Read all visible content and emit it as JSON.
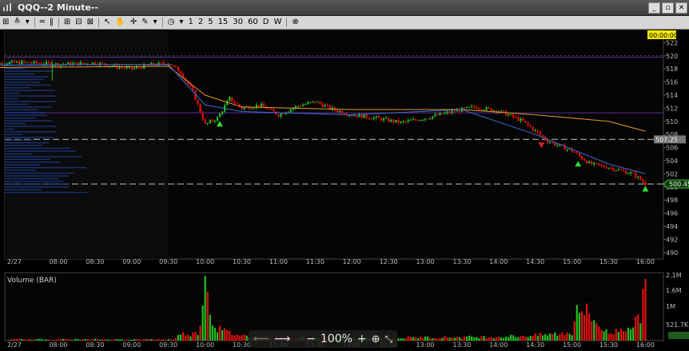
{
  "window": {
    "title": "QQQ--2 Minute--",
    "min_label": "_",
    "restore_label": "▫",
    "close_label": "✕"
  },
  "toolbar": {
    "timeframes": [
      "1",
      "2",
      "5",
      "15",
      "30",
      "60",
      "D",
      "W"
    ]
  },
  "price_label_top": "00:00:00",
  "price_markers": {
    "upper": "507.25",
    "last": "500.45"
  },
  "volume_title": "Volume (BAR)",
  "nav": {
    "zoom": "100%"
  },
  "colors": {
    "up": "#21c021",
    "down": "#e01010",
    "bg": "#000000",
    "ema_slow": "#e8962a",
    "ema_fast": "#3a6fd8"
  },
  "chart_data": {
    "type": "candlestick",
    "date_label": "2/27",
    "x_ticks": [
      "08:00",
      "08:30",
      "09:00",
      "09:30",
      "10:00",
      "10:30",
      "11:00",
      "11:30",
      "12:00",
      "12:30",
      "13:00",
      "13:30",
      "14:00",
      "14:30",
      "15:00",
      "15:30",
      "16:00"
    ],
    "y_ticks": [
      490,
      492,
      494,
      496,
      498,
      500,
      502,
      504,
      506,
      508,
      510,
      512,
      514,
      516,
      518,
      520,
      522
    ],
    "ylim": [
      489,
      524
    ],
    "volume_ticks": [
      "2.1M",
      "1.6M",
      "1M",
      "521.7K"
    ],
    "volume_max": 2100000,
    "close_path": [
      [
        "07:00",
        518.8
      ],
      [
        "07:30",
        519.0
      ],
      [
        "08:00",
        518.7
      ],
      [
        "08:30",
        518.9
      ],
      [
        "09:00",
        518.0
      ],
      [
        "09:15",
        518.6
      ],
      [
        "09:30",
        518.9
      ],
      [
        "09:40",
        517.5
      ],
      [
        "09:50",
        514.5
      ],
      [
        "10:00",
        509.5
      ],
      [
        "10:10",
        510.5
      ],
      [
        "10:20",
        513.5
      ],
      [
        "10:30",
        512.0
      ],
      [
        "10:45",
        512.5
      ],
      [
        "11:00",
        511.0
      ],
      [
        "11:15",
        512.3
      ],
      [
        "11:30",
        513.0
      ],
      [
        "11:45",
        511.8
      ],
      [
        "12:00",
        511.0
      ],
      [
        "12:20",
        510.5
      ],
      [
        "12:40",
        509.8
      ],
      [
        "13:00",
        510.5
      ],
      [
        "13:20",
        511.4
      ],
      [
        "13:40",
        512.2
      ],
      [
        "14:00",
        511.6
      ],
      [
        "14:20",
        510.0
      ],
      [
        "14:40",
        507.0
      ],
      [
        "15:00",
        505.5
      ],
      [
        "15:15",
        503.5
      ],
      [
        "15:30",
        503.0
      ],
      [
        "15:50",
        502.0
      ],
      [
        "16:00",
        500.5
      ]
    ],
    "ema_slow": [
      [
        "07:00",
        518.2
      ],
      [
        "09:30",
        518.4
      ],
      [
        "10:00",
        514.0
      ],
      [
        "10:30",
        512.2
      ],
      [
        "12:00",
        511.8
      ],
      [
        "13:30",
        511.8
      ],
      [
        "14:30",
        511.0
      ],
      [
        "15:30",
        510.0
      ],
      [
        "16:00",
        508.5
      ]
    ],
    "ema_fast": [
      [
        "07:00",
        518.6
      ],
      [
        "09:30",
        518.7
      ],
      [
        "10:00",
        512.5
      ],
      [
        "10:30",
        511.5
      ],
      [
        "12:00",
        511.0
      ],
      [
        "13:30",
        511.8
      ],
      [
        "14:30",
        508.0
      ],
      [
        "15:30",
        503.5
      ],
      [
        "16:00",
        502.0
      ]
    ],
    "hlines": [
      520.0,
      507.25,
      500.45
    ],
    "purple_lines": [
      519.8,
      511.3
    ],
    "up_arrows": [
      [
        "10:12",
        509.7
      ],
      [
        "15:05",
        503.6
      ],
      [
        "16:00",
        499.8
      ]
    ],
    "down_arrows": [
      [
        "14:35",
        506.3
      ]
    ],
    "volume": [
      [
        "09:35",
        0.05
      ],
      [
        "09:40",
        0.09
      ],
      [
        "09:45",
        0.12
      ],
      [
        "09:50",
        0.1
      ],
      [
        "09:55",
        0.14
      ],
      [
        "10:00",
        1.0
      ],
      [
        "10:05",
        0.35
      ],
      [
        "10:10",
        0.2
      ],
      [
        "10:15",
        0.15
      ],
      [
        "10:20",
        0.12
      ],
      [
        "10:25",
        0.1
      ],
      [
        "10:30",
        0.08
      ],
      [
        "11:00",
        0.05
      ],
      [
        "12:00",
        0.04
      ],
      [
        "13:00",
        0.05
      ],
      [
        "14:00",
        0.06
      ],
      [
        "14:30",
        0.08
      ],
      [
        "15:00",
        0.12
      ],
      [
        "15:05",
        0.55
      ],
      [
        "15:30",
        0.1
      ],
      [
        "15:55",
        0.3
      ],
      [
        "16:00",
        0.95
      ]
    ]
  }
}
